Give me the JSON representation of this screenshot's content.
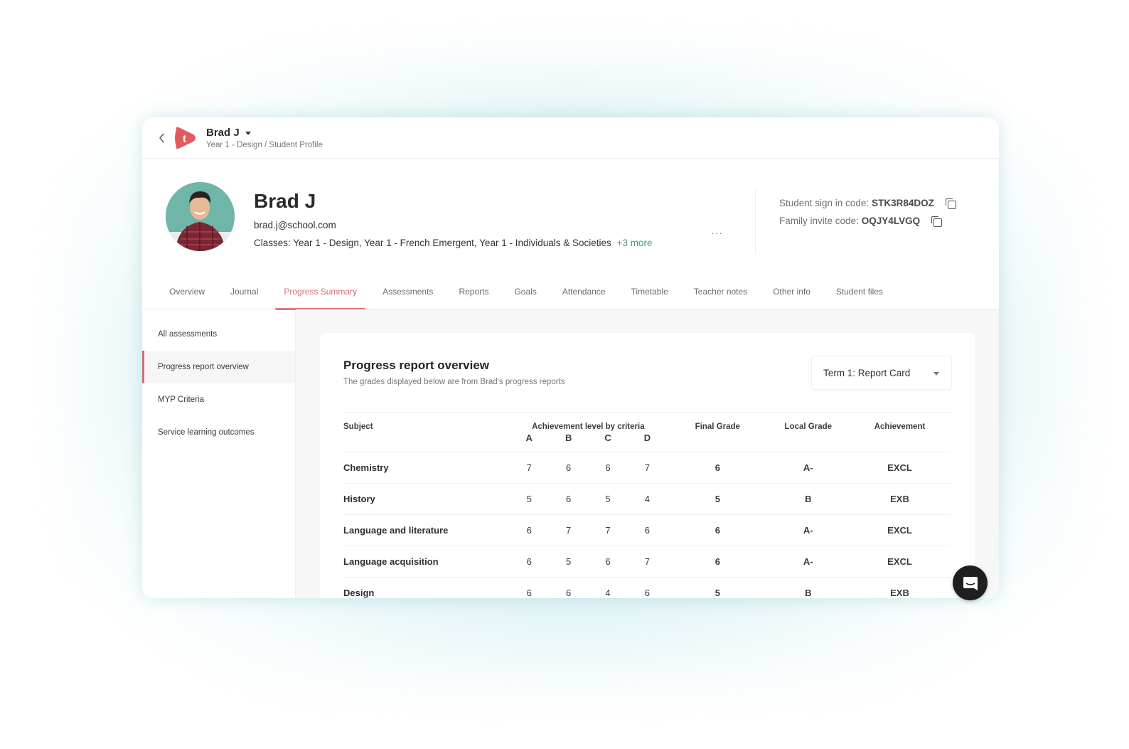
{
  "topbar": {
    "student_name": "Brad J",
    "breadcrumb": "Year 1 - Design / Student Profile",
    "logo_letter": "t",
    "brand_color": "#e05a5e"
  },
  "profile": {
    "name": "Brad J",
    "email": "brad.j@school.com",
    "classes_label": "Classes: Year 1 - Design, Year 1 - French Emergent, Year 1 - Individuals & Societies",
    "more_link": "+3 more",
    "ellipsis": "···",
    "student_code_label": "Student sign in code:",
    "student_code": "STK3R84DOZ",
    "family_code_label": "Family invite code:",
    "family_code": "OQJY4LVGQ"
  },
  "tabs": [
    {
      "label": "Overview",
      "active": false
    },
    {
      "label": "Journal",
      "active": false
    },
    {
      "label": "Progress Summary",
      "active": true
    },
    {
      "label": "Assessments",
      "active": false
    },
    {
      "label": "Reports",
      "active": false
    },
    {
      "label": "Goals",
      "active": false
    },
    {
      "label": "Attendance",
      "active": false
    },
    {
      "label": "Timetable",
      "active": false
    },
    {
      "label": "Teacher notes",
      "active": false
    },
    {
      "label": "Other info",
      "active": false
    },
    {
      "label": "Student files",
      "active": false
    }
  ],
  "sidebar": {
    "items": [
      {
        "label": "All assessments",
        "active": false
      },
      {
        "label": "Progress report overview",
        "active": true
      },
      {
        "label": "MYP Criteria",
        "active": false
      },
      {
        "label": "Service learning outcomes",
        "active": false
      }
    ]
  },
  "report": {
    "title": "Progress report overview",
    "subtitle": "The grades displayed below are from Brad's progress reports",
    "term_select": "Term 1: Report Card",
    "headers": {
      "subject": "Subject",
      "criteria_group": "Achievement level by criteria",
      "criteria": [
        "A",
        "B",
        "C",
        "D"
      ],
      "final_grade": "Final Grade",
      "local_grade": "Local Grade",
      "achievement": "Achievement"
    },
    "rows": [
      {
        "subject": "Chemistry",
        "A": "7",
        "B": "6",
        "C": "6",
        "D": "7",
        "final": "6",
        "local": "A-",
        "achievement": "EXCL"
      },
      {
        "subject": "History",
        "A": "5",
        "B": "6",
        "C": "5",
        "D": "4",
        "final": "5",
        "local": "B",
        "achievement": "EXB"
      },
      {
        "subject": "Language and literature",
        "A": "6",
        "B": "7",
        "C": "7",
        "D": "6",
        "final": "6",
        "local": "A-",
        "achievement": "EXCL"
      },
      {
        "subject": "Language acquisition",
        "A": "6",
        "B": "5",
        "C": "6",
        "D": "7",
        "final": "6",
        "local": "A-",
        "achievement": "EXCL"
      },
      {
        "subject": "Design",
        "A": "6",
        "B": "6",
        "C": "4",
        "D": "6",
        "final": "5",
        "local": "B",
        "achievement": "EXB"
      }
    ]
  },
  "chat": {
    "icon": "chat-bubble-icon"
  }
}
